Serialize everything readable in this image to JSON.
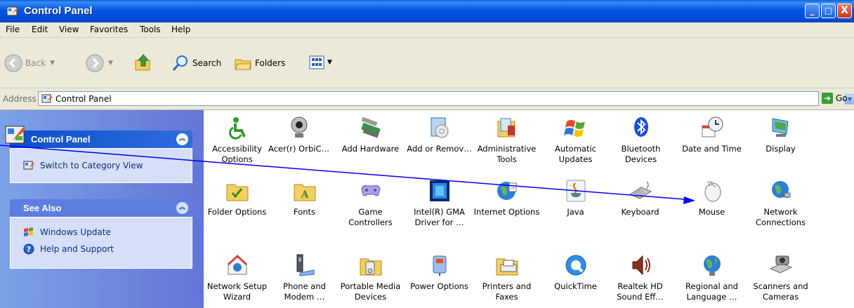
{
  "window": {
    "title": "Control Panel",
    "buttons": {
      "minimize": "_",
      "maximize": "□",
      "close": "X"
    }
  },
  "menubar": [
    "File",
    "Edit",
    "View",
    "Favorites",
    "Tools",
    "Help"
  ],
  "toolbar": {
    "back": "Back",
    "search": "Search",
    "folders": "Folders"
  },
  "address": {
    "label": "Address",
    "value": "Control Panel",
    "go": "Go"
  },
  "sidebar": {
    "control_panel": {
      "title": "Control Panel",
      "link": "Switch to Category View"
    },
    "see_also": {
      "title": "See Also",
      "links": [
        "Windows Update",
        "Help and Support"
      ]
    }
  },
  "items": [
    {
      "label": "Accessibility Options",
      "icon": "accessibility-icon"
    },
    {
      "label": "Acer(r) OrbiC…",
      "icon": "webcam-icon"
    },
    {
      "label": "Add Hardware",
      "icon": "add-hardware-icon"
    },
    {
      "label": "Add or Remov…",
      "icon": "add-remove-programs-icon"
    },
    {
      "label": "Administrative Tools",
      "icon": "admin-tools-icon"
    },
    {
      "label": "Automatic Updates",
      "icon": "windows-update-icon"
    },
    {
      "label": "Bluetooth Devices",
      "icon": "bluetooth-icon"
    },
    {
      "label": "Date and Time",
      "icon": "date-time-icon"
    },
    {
      "label": "Display",
      "icon": "display-icon"
    },
    {
      "label": "Folder Options",
      "icon": "folder-options-icon"
    },
    {
      "label": "Fonts",
      "icon": "fonts-folder-icon"
    },
    {
      "label": "Game Controllers",
      "icon": "gamepad-icon"
    },
    {
      "label": "Intel(R) GMA Driver for …",
      "icon": "intel-gma-icon"
    },
    {
      "label": "Internet Options",
      "icon": "internet-options-icon"
    },
    {
      "label": "Java",
      "icon": "java-icon"
    },
    {
      "label": "Keyboard",
      "icon": "keyboard-icon"
    },
    {
      "label": "Mouse",
      "icon": "mouse-icon"
    },
    {
      "label": "Network Connections",
      "icon": "network-connections-icon"
    },
    {
      "label": "Network Setup Wizard",
      "icon": "network-setup-icon"
    },
    {
      "label": "Phone and Modem …",
      "icon": "phone-modem-icon"
    },
    {
      "label": "Portable Media Devices",
      "icon": "portable-media-icon"
    },
    {
      "label": "Power Options",
      "icon": "power-options-icon"
    },
    {
      "label": "Printers and Faxes",
      "icon": "printer-icon"
    },
    {
      "label": "QuickTime",
      "icon": "quicktime-icon"
    },
    {
      "label": "Realtek HD Sound Eff…",
      "icon": "speaker-icon"
    },
    {
      "label": "Regional and Language …",
      "icon": "globe-icon"
    },
    {
      "label": "Scanners and Cameras",
      "icon": "scanner-camera-icon"
    }
  ],
  "colors": {
    "title_bar": "#0055e5",
    "sidebar": "#6b8ee0",
    "panel_body": "#d6dff7",
    "annotation_line": "#0000ff"
  }
}
